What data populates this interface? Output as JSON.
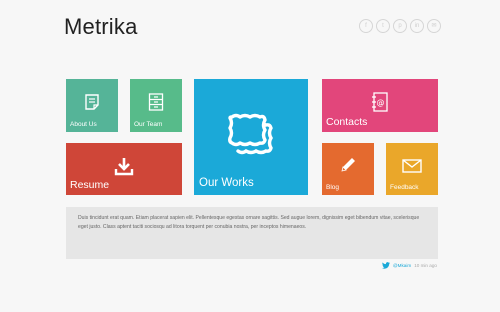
{
  "header": {
    "title": "Metrika",
    "social": [
      {
        "icon": "facebook-icon",
        "glyph": "f"
      },
      {
        "icon": "twitter-icon",
        "glyph": "t"
      },
      {
        "icon": "pinterest-icon",
        "glyph": "p"
      },
      {
        "icon": "linkedin-icon",
        "glyph": "in"
      },
      {
        "icon": "email-icon",
        "glyph": "✉"
      }
    ]
  },
  "tiles": {
    "about": {
      "label": "About Us",
      "color": "#55b498",
      "icon": "note-icon"
    },
    "team": {
      "label": "Our Team",
      "color": "#57bb8a",
      "icon": "cabinet-icon"
    },
    "works": {
      "label": "Our Works",
      "color": "#1ba9d8",
      "icon": "picture-frames-icon"
    },
    "contacts": {
      "label": "Contacts",
      "color": "#e2467b",
      "icon": "address-book-icon"
    },
    "resume": {
      "label": "Resume",
      "color": "#cf4638",
      "icon": "download-icon"
    },
    "blog": {
      "label": "Blog",
      "color": "#e46a2f",
      "icon": "pencil-icon"
    },
    "feedback": {
      "label": "Feedback",
      "color": "#eaa72a",
      "icon": "envelope-icon"
    }
  },
  "tweet": {
    "text": "Duis tincidunt erat quam. Etiam placerat sapien elit. Pellentesque egestas ornare sagittis. Sed augue lorem, dignissim eget bibendum vitae, scelerisque eget justo. Class aptent taciti sociosqu ad litora torquent per conubia nostra, per inceptos himenaeos.",
    "handle": "@Mkaim",
    "time": "10 min ago"
  }
}
